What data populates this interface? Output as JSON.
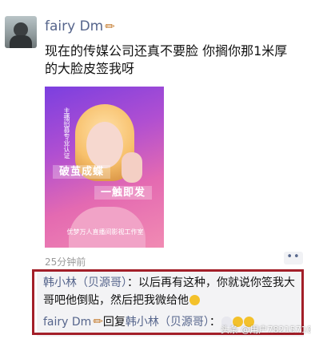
{
  "post": {
    "username": "fairy  Dm",
    "text": "现在的传媒公司还真不要脸 你搁你那1米厚的大脸皮签我呀",
    "time": "25分钟前",
    "more_label": "••"
  },
  "image": {
    "banner_1": "破茧成蝶",
    "banner_2": "一触即发",
    "top_text": "主播招募专业认证",
    "bottom_text": "优梦万人直播间影视工作室"
  },
  "comments": [
    {
      "author": "韩小林（贝源哥）",
      "separator": "：",
      "text": "以后再有这种，你就说你签我大哥吧他倒贴，然后把我微给他"
    },
    {
      "author": "fairy  Dm",
      "reply_word": "回复",
      "reply_to": "韩小林（贝源哥）",
      "separator": "："
    }
  ],
  "watermark": "头条 @用户7821571019",
  "colors": {
    "name_blue": "#56658c",
    "frame_red": "#a31f29"
  },
  "icons": {
    "pencil": "pencil-icon",
    "more": "more-dots-icon"
  }
}
